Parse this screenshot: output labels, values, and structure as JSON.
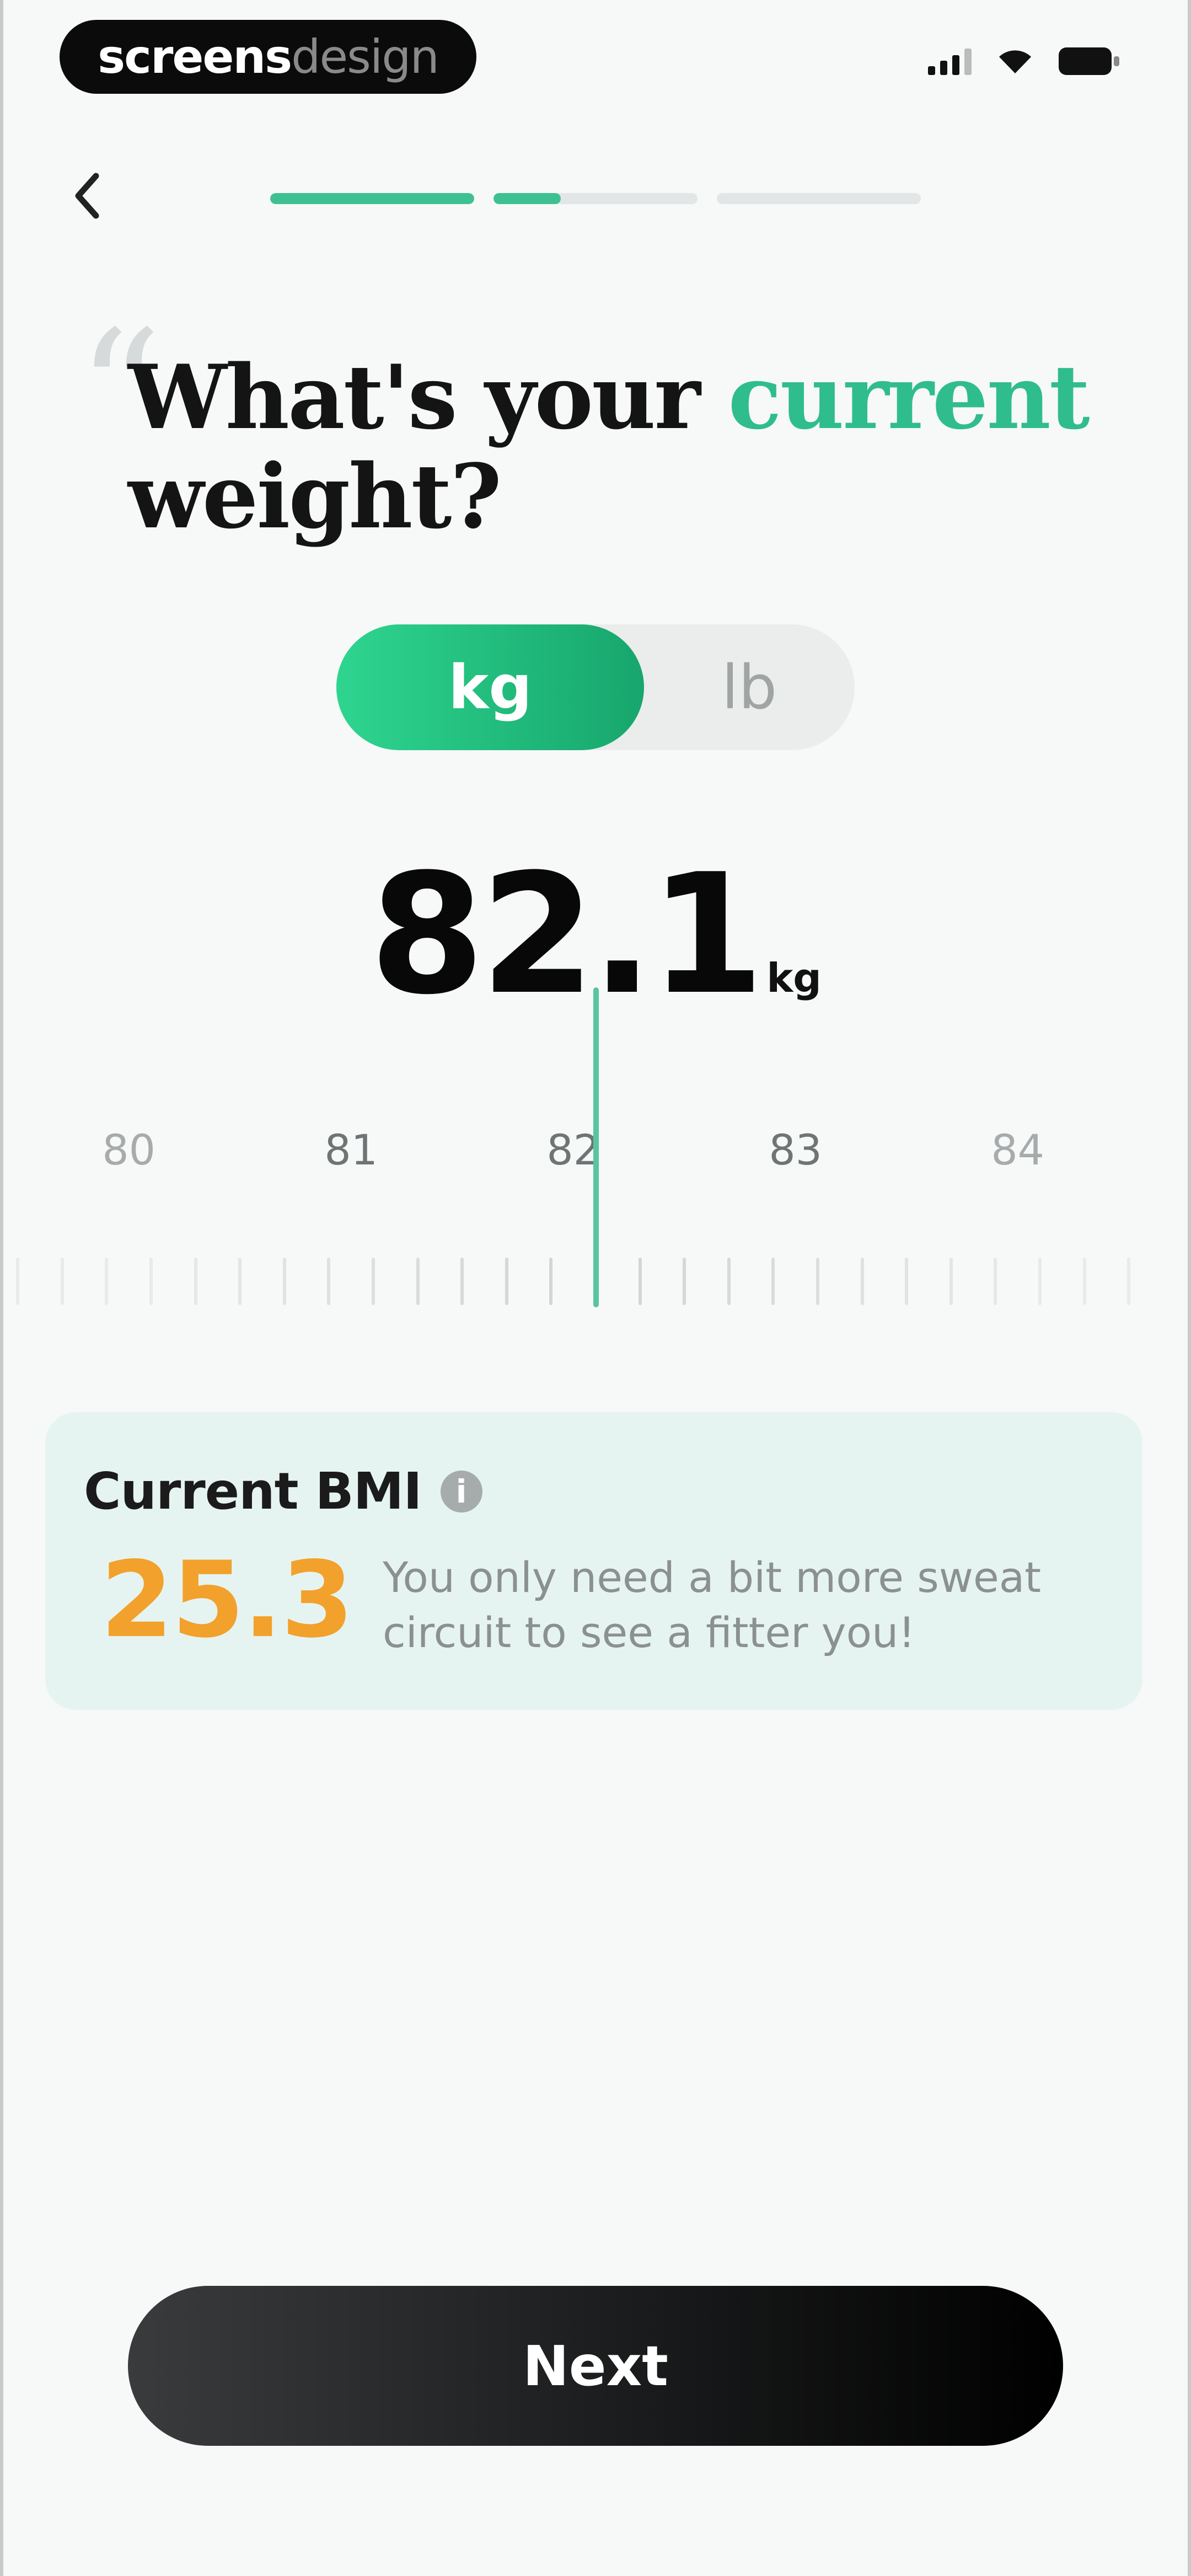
{
  "status_bar": {
    "brand_part1": "screens",
    "brand_part2": "design"
  },
  "header": {
    "progress": [
      {
        "filled": 1.0
      },
      {
        "filled": 0.33
      },
      {
        "filled": 0.0
      }
    ]
  },
  "title": {
    "line_before_accent": "What's your ",
    "accent": "current",
    "line_after_accent": "weight?"
  },
  "unit_toggle": {
    "selected": "kg",
    "option_kg": "kg",
    "option_lb": "lb"
  },
  "weight": {
    "value": "82.1",
    "unit": "kg"
  },
  "ruler": {
    "labels": [
      "80",
      "81",
      "82",
      "83",
      "84"
    ],
    "min": 79.5,
    "max": 84.5,
    "step": 0.2,
    "selected_value": 82.1
  },
  "bmi": {
    "label": "Current BMI",
    "value": "25.3",
    "message": "You only need a bit more sweat circuit to see a fitter you!"
  },
  "cta": {
    "next_label": "Next"
  },
  "colors": {
    "accent_green": "#2fbd8e",
    "bmi_orange": "#f2a12c",
    "card_bg": "#e6f4f1"
  }
}
